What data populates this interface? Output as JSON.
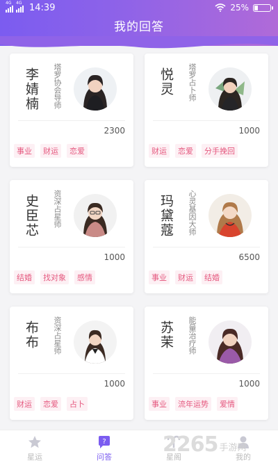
{
  "status_bar": {
    "net1": "4G",
    "net2": "4G",
    "time": "14:39",
    "battery": "25%"
  },
  "page": {
    "title": "我的回答"
  },
  "cards": [
    {
      "name": "李婧楠",
      "title": "塔罗协会导师",
      "count": "2300",
      "tags": [
        "事业",
        "财运",
        "恋爱"
      ]
    },
    {
      "name": "悦灵",
      "title": "塔罗占卜师",
      "count": "1000",
      "tags": [
        "财运",
        "恋爱",
        "分手挽回"
      ]
    },
    {
      "name": "史臣芯",
      "title": "资深占星师",
      "count": "1000",
      "tags": [
        "结婚",
        "找对象",
        "感情"
      ]
    },
    {
      "name": "玛黛蔻",
      "title": "心灵基因大师",
      "count": "6500",
      "tags": [
        "事业",
        "财运",
        "结婚"
      ]
    },
    {
      "name": "布布",
      "title": "资深占星师",
      "count": "1000",
      "tags": [
        "财运",
        "恋爱",
        "占卜"
      ]
    },
    {
      "name": "苏茉",
      "title": "能量治疗师",
      "count": "1000",
      "tags": [
        "事业",
        "流年运势",
        "爱情"
      ]
    }
  ],
  "tabbar": {
    "tabs": [
      {
        "label": "星运",
        "icon": "star-icon"
      },
      {
        "label": "问答",
        "icon": "question-icon",
        "active": true
      },
      {
        "label": "星阁",
        "icon": "aries-icon"
      },
      {
        "label": "我的",
        "icon": "user-icon"
      }
    ]
  },
  "watermark": {
    "number": "2265",
    "site": "手游网"
  },
  "colors": {
    "accent": "#7b5cf0",
    "tag_text": "#e5597f",
    "tag_bg": "#fdf0f4"
  }
}
